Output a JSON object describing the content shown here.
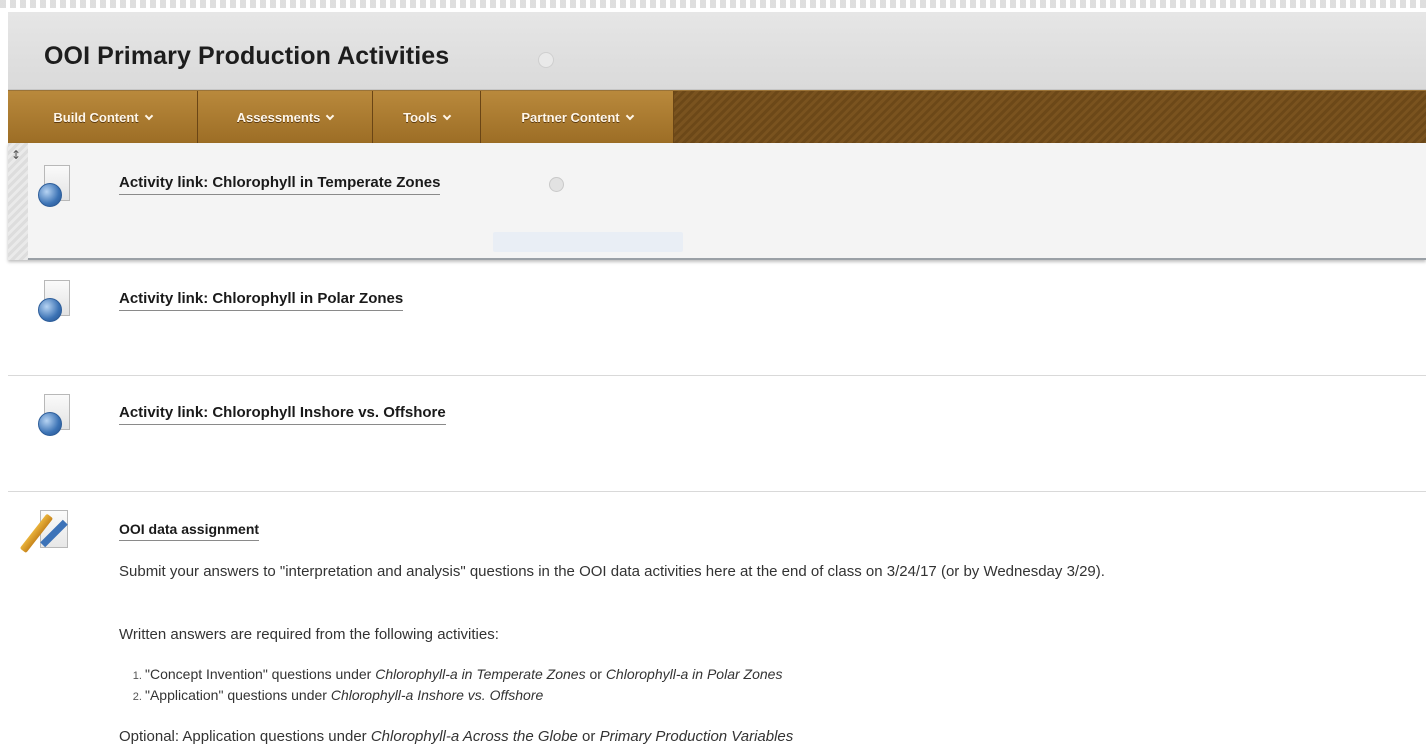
{
  "page": {
    "title": "OOI Primary Production Activities"
  },
  "toolbar": {
    "tabs": [
      {
        "label": "Build Content"
      },
      {
        "label": "Assessments"
      },
      {
        "label": "Tools"
      },
      {
        "label": "Partner Content"
      }
    ]
  },
  "items": [
    {
      "title": "Activity link: Chlorophyll in Temperate Zones",
      "icon": "web-link-icon"
    },
    {
      "title": "Activity link: Chlorophyll in Polar Zones",
      "icon": "web-link-icon"
    },
    {
      "title": "Activity link: Chlorophyll Inshore vs. Offshore",
      "icon": "web-link-icon"
    },
    {
      "title": "OOI data assignment",
      "icon": "assignment-icon"
    }
  ],
  "assignment": {
    "para1": "Submit your answers to \"interpretation and analysis\" questions in the OOI data activities here at the end of class on 3/24/17 (or by Wednesday 3/29).",
    "para2": "Written answers are required from the following activities:",
    "list": [
      {
        "a": "\"Concept Invention\" questions under ",
        "b": "Chlorophyll-a in Temperate Zones",
        "c": " or ",
        "d": "Chlorophyll-a in Polar Zones"
      },
      {
        "a": "\"Application\" questions under ",
        "b": "Chlorophyll-a Inshore vs. Offshore"
      }
    ],
    "optional": {
      "a": "Optional: Application questions under ",
      "b": "Chlorophyll-a Across the Globe",
      "c": " or ",
      "d": "Primary Production Variables"
    }
  }
}
